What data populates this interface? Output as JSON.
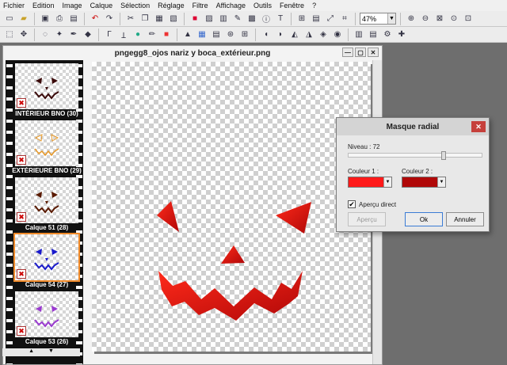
{
  "menu": [
    "Fichier",
    "Edition",
    "Image",
    "Calque",
    "Sélection",
    "Réglage",
    "Filtre",
    "Affichage",
    "Outils",
    "Fenêtre",
    "?"
  ],
  "toolbar": {
    "zoom_value": "47%"
  },
  "document": {
    "title": "pngegg8_ojos nariz y boca_extérieur.png"
  },
  "layers": [
    {
      "name": "INTÉRIEUR BNO (30)",
      "color": "#3a0a0a"
    },
    {
      "name": "EXTÉRIEURE BNO (29)",
      "color": "#e89a2a"
    },
    {
      "name": "Calque 51 (28)",
      "color": "#5a1a00"
    },
    {
      "name": "Calque 54 (27)",
      "color": "#1a1acc"
    },
    {
      "name": "Calque 53 (26)",
      "color": "#9a3ad0"
    }
  ],
  "dialog": {
    "title": "Masque radial",
    "level_label": "Niveau : 72",
    "level_value": 72,
    "level_max": 100,
    "color1_label": "Couleur 1 :",
    "color1": "#ff1a1a",
    "color2_label": "Couleur 2 :",
    "color2": "#b00808",
    "live_preview_label": "Aperçu direct",
    "live_preview_checked": true,
    "preview_button": "Aperçu",
    "ok_button": "Ok",
    "cancel_button": "Annuler"
  }
}
